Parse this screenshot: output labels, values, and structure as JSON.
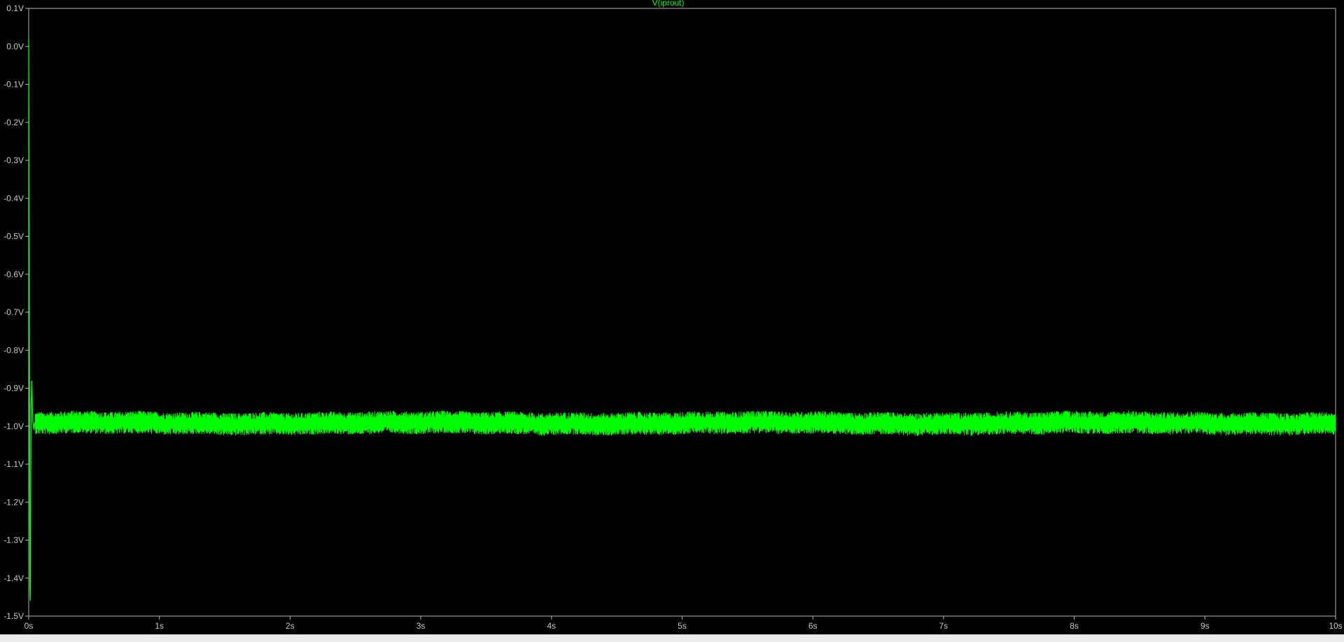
{
  "colors": {
    "background": "#000000",
    "axis": "#b4b4b4",
    "grid": "#2b2b2b",
    "trace": "#00ff00",
    "axis_text": "#c8c8c8"
  },
  "chart_data": {
    "type": "line",
    "title": "V(iprout)",
    "xlabel": "",
    "ylabel": "",
    "xlim": [
      0,
      10
    ],
    "ylim": [
      -1.5,
      0.1
    ],
    "x_ticks": [
      "0s",
      "1s",
      "2s",
      "3s",
      "4s",
      "5s",
      "6s",
      "7s",
      "8s",
      "9s",
      "10s"
    ],
    "x_tick_values": [
      0,
      1,
      2,
      3,
      4,
      5,
      6,
      7,
      8,
      9,
      10
    ],
    "y_ticks": [
      "0.1V",
      "0.0V",
      "-0.1V",
      "-0.2V",
      "-0.3V",
      "-0.4V",
      "-0.5V",
      "-0.6V",
      "-0.7V",
      "-0.8V",
      "-0.9V",
      "-1.0V",
      "-1.1V",
      "-1.2V",
      "-1.3V",
      "-1.4V",
      "-1.5V"
    ],
    "y_tick_values": [
      0.1,
      0.0,
      -0.1,
      -0.2,
      -0.3,
      -0.4,
      -0.5,
      -0.6,
      -0.7,
      -0.8,
      -0.9,
      -1.0,
      -1.1,
      -1.2,
      -1.3,
      -1.4,
      -1.5
    ],
    "grid": false,
    "series": [
      {
        "name": "V(iprout)",
        "color": "#00ff00",
        "transient": {
          "x": [
            0.0,
            0.003,
            0.006,
            0.009,
            0.012,
            0.015,
            0.018,
            0.021,
            0.024,
            0.027,
            0.03,
            0.033,
            0.036,
            0.04,
            0.045,
            0.05
          ],
          "y": [
            0.02,
            -0.3,
            -0.9,
            -1.42,
            -1.46,
            -1.2,
            -0.95,
            -0.92,
            -0.88,
            -0.93,
            -0.97,
            -0.99,
            -1.0,
            -1.01,
            -0.99,
            -1.0
          ]
        },
        "steady_state": {
          "x_start": 0.05,
          "x_end": 10,
          "mean": -0.992,
          "noise_min": -1.022,
          "noise_max": -0.962
        }
      }
    ]
  }
}
